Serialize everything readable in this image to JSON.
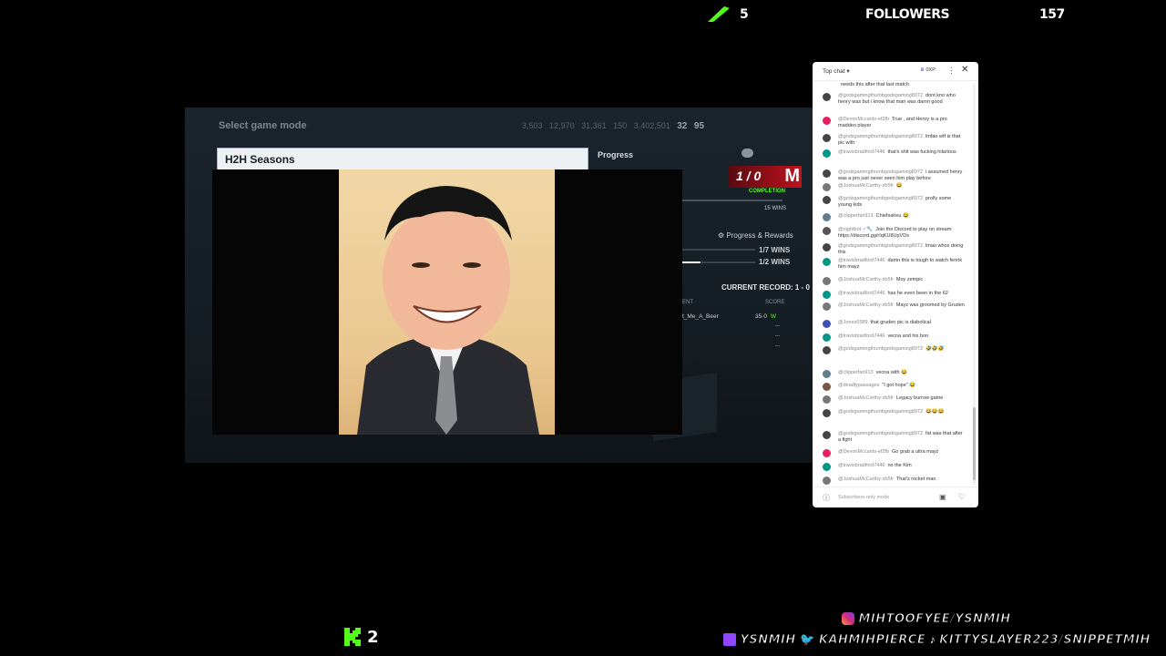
{
  "top_overlay": {
    "sub_count": "5",
    "followers_label": "FOLLOWERS",
    "followers_count": "157"
  },
  "game": {
    "mode_label": "Select game mode",
    "currency": [
      "3,503",
      "12,970",
      "31,361",
      "150",
      "3,402,501"
    ],
    "currency_label_a": "32",
    "currency_label_b": "95",
    "h2h_title": "H2H Seasons",
    "progress_label": "Progress",
    "badge_text": "1 / 0",
    "completion_label": "COMPLETION",
    "wins_15": "15 WINS",
    "progress_rewards": "Progress & Rewards",
    "wins_1_7": "1/7 WINS",
    "wins_1_2": "1/2 WINS",
    "current_record": "CURRENT RECORD: 1 - 0",
    "col_opponent": "ENT",
    "col_score": "SCORE",
    "opponent_name": "t_Me_A_Beer",
    "score_value": "35-0",
    "score_result": "W",
    "dashes": [
      "---",
      "---",
      "---"
    ]
  },
  "chat": {
    "title": "Top chat",
    "points": "0XP",
    "footer_placeholder": "Subscribers-only mode",
    "messages": [
      {
        "author": "",
        "text": "needs this after that last match",
        "color": "#888888"
      },
      {
        "author": "@godsgamingthumbgodsgaming8972",
        "text": "dont kno who henry was but i know that man was damn good",
        "color": "#444444"
      },
      {
        "author": "@DevonMccants-ef2fb",
        "text": "True , and Henry is a pro madden player",
        "color": "#e91e63"
      },
      {
        "author": "@godsgamingthumbgodsgaming8972",
        "text": "lmfao wtf is that pic with",
        "color": "#444444"
      },
      {
        "author": "@travisbradford7446",
        "text": "that's shit was fucking hilarious",
        "color": "#009688"
      },
      {
        "author": "@godsgamingthumbgodsgaming8972",
        "text": "i assumed henry was a pro just never seen him play before",
        "color": "#444444"
      },
      {
        "author": "@JoshuaMcCarthy-zb5fr",
        "text": "😂",
        "color": "#777777"
      },
      {
        "author": "@godsgamingthumbgodsgaming8972",
        "text": "prolly some young kids",
        "color": "#444444"
      },
      {
        "author": "@clipperfan913",
        "text": "Chiefsaheu 😂",
        "color": "#607d8b"
      },
      {
        "author": "@nightbot ✓🔧",
        "text": "Join the Discord to play on stream: https://discord.gg/rIqKU8UpVDs",
        "color": "#555555"
      },
      {
        "author": "@godsgamingthumbgodsgaming8972",
        "text": "lmao whos doing this",
        "color": "#444444"
      },
      {
        "author": "@travisbradford7446",
        "text": "damn this is tough to watch fenrik him mayz",
        "color": "#009688"
      },
      {
        "author": "@JoshuaMcCarthy-zb5fr",
        "text": "Moy zempic",
        "color": "#777777"
      },
      {
        "author": "@travisbradford7446",
        "text": "has he even been in the 62",
        "color": "#009688"
      },
      {
        "author": "@JoshuaMcCarthy-zb5fr",
        "text": "Mayz was groomed by Gruden",
        "color": "#777777"
      },
      {
        "author": "@Jones6589",
        "text": "that gruden pic is diabolical",
        "color": "#3f51b5"
      },
      {
        "author": "@travisbradford7446",
        "text": "vecna and his boo",
        "color": "#009688"
      },
      {
        "author": "@godsgamingthumbgodsgaming8972",
        "text": "🤣🤣🤣",
        "color": "#444444"
      },
      {
        "author": "@clipperfan913",
        "text": "vecna with 😂",
        "color": "#607d8b"
      },
      {
        "author": "@deadlypassages",
        "text": "\"I got hope\" 😂",
        "color": "#795548"
      },
      {
        "author": "@JoshuaMcCarthy-zb5fr",
        "text": "Legacy burrow game",
        "color": "#777777"
      },
      {
        "author": "@godsgamingthumbgodsgaming8972",
        "text": "😂😂😂",
        "color": "#444444"
      },
      {
        "author": "@godsgamingthumbgodsgaming8972",
        "text": "fat was that after a fight",
        "color": "#444444"
      },
      {
        "author": "@DevonMccants-ef2fb",
        "text": "Go grab a ultra mayz",
        "color": "#e91e63"
      },
      {
        "author": "@travisbradford7446",
        "text": "no the Kim",
        "color": "#009688"
      },
      {
        "author": "@JoshuaMcCarthy-zb5fr",
        "text": "That's rocket man",
        "color": "#777777"
      }
    ]
  },
  "overlay_bottom": {
    "kick_count": "2",
    "instagram": "MIHTOOFYEE/YSNMIH",
    "twitch": "YSNMIH",
    "twitter": "KAHMIHPIERCE",
    "tiktok": "KITTYSLAYER223/SNIPPETMIH"
  },
  "colors": {
    "accent_green": "#53fc18",
    "badge_red": "#c0121f"
  }
}
